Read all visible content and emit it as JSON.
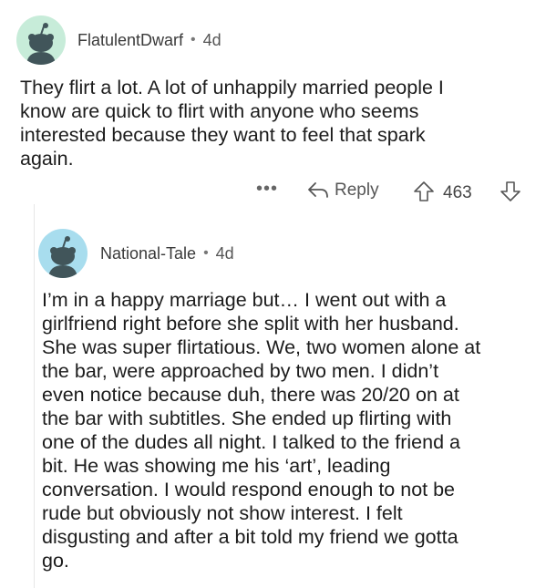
{
  "comments": [
    {
      "username": "FlatulentDwarf",
      "separator": "•",
      "age": "4d",
      "avatar_icon": "snoo-avatar-icon",
      "body": "They flirt a lot. A lot of unhappily married people I\nknow are quick to flirt with anyone who seems\ninterested because they want to feel that spark\nagain.",
      "actions": {
        "more": "•••",
        "reply_label": "Reply",
        "score": "463"
      }
    },
    {
      "username": "National-Tale",
      "separator": "•",
      "age": "4d",
      "avatar_icon": "snoo-avatar-icon",
      "body": "I’m in a happy marriage but… I went out with a\ngirlfriend right before she split with her husband.\nShe was super flirtatious. We, two women alone at\nthe bar,  were approached by two men. I didn’t\neven notice because duh, there was 20/20 on at\nthe bar with subtitles. She ended up flirting with\none of the dudes all night. I talked to the friend a\nbit. He was showing me his ‘art’, leading\nconversation. I would respond enough to not be\nrude but obviously not show interest. I felt\ndisgusting and after a bit told my friend we gotta\ngo."
    }
  ],
  "colors": {
    "avatar1_bg": "#c7ecd9",
    "avatar2_bg": "#a8ddee",
    "snoo": "#41555a",
    "text": "#1c1c1c"
  }
}
